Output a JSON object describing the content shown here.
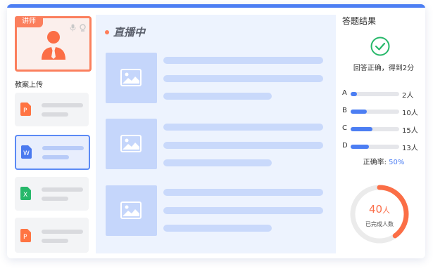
{
  "teacher": {
    "tag": "讲师"
  },
  "lesson": {
    "section_title": "教案上传"
  },
  "files": [
    {
      "type": "P",
      "color": "#ff7443"
    },
    {
      "type": "W",
      "color": "#4a79ef"
    },
    {
      "type": "X",
      "color": "#27b86a"
    },
    {
      "type": "P",
      "color": "#ff7443"
    }
  ],
  "live": {
    "title": "直播中"
  },
  "result": {
    "title": "答题结果",
    "message": "回答正确，得到2分",
    "options": [
      {
        "letter": "A",
        "count": "2人",
        "fill": 0.13
      },
      {
        "letter": "B",
        "count": "10人",
        "fill": 0.33
      },
      {
        "letter": "C",
        "count": "15人",
        "fill": 0.45
      },
      {
        "letter": "D",
        "count": "13人",
        "fill": 0.37
      }
    ],
    "accuracy_label": "正确率:",
    "accuracy_value": "50%",
    "completed_num": "40",
    "completed_unit": "人",
    "completed_label": "已完成人数",
    "completed_progress": 0.4
  },
  "colors": {
    "accent": "#4c7ef3",
    "brand": "#fb7f5d"
  }
}
